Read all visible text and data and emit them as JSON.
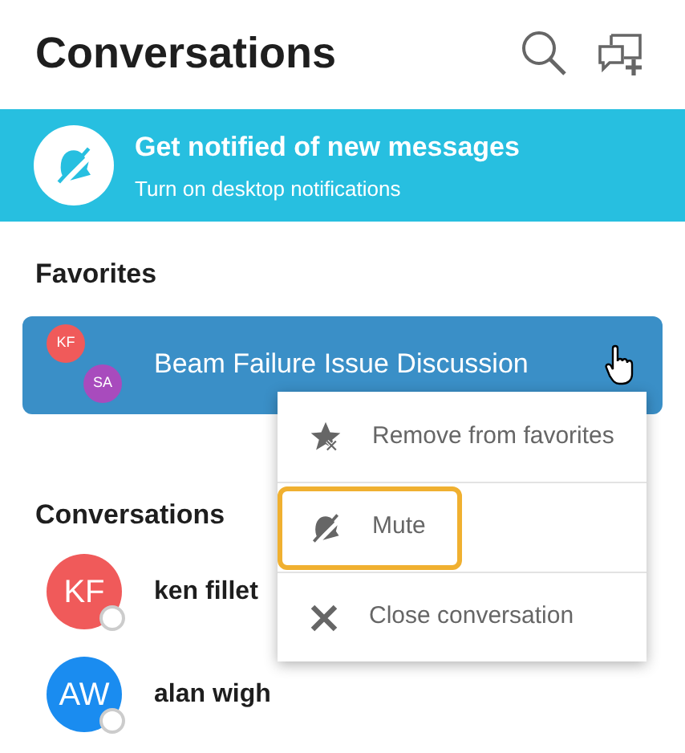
{
  "header": {
    "title": "Conversations"
  },
  "banner": {
    "title": "Get notified of new messages",
    "subtitle": "Turn on desktop notifications"
  },
  "favorites": {
    "heading": "Favorites",
    "items": [
      {
        "title": "Beam Failure Issue Discussion",
        "selected": true,
        "avatars": [
          {
            "initials": "KF",
            "color": "#f05a5a"
          },
          {
            "initials": "SA",
            "color": "#a84bbd"
          }
        ]
      }
    ]
  },
  "context_menu": {
    "items": [
      {
        "kind": "unfavorite",
        "label": "Remove from favorites",
        "highlighted": false
      },
      {
        "kind": "mute",
        "label": "Mute",
        "highlighted": true
      },
      {
        "kind": "close",
        "label": "Close conversation",
        "highlighted": false
      }
    ]
  },
  "conversations": {
    "heading": "Conversations",
    "items": [
      {
        "name": "ken fillet",
        "initials": "KF",
        "color": "#f05a5a"
      },
      {
        "name": "alan wigh",
        "initials": "AW",
        "color": "#1a8cf0"
      }
    ]
  }
}
